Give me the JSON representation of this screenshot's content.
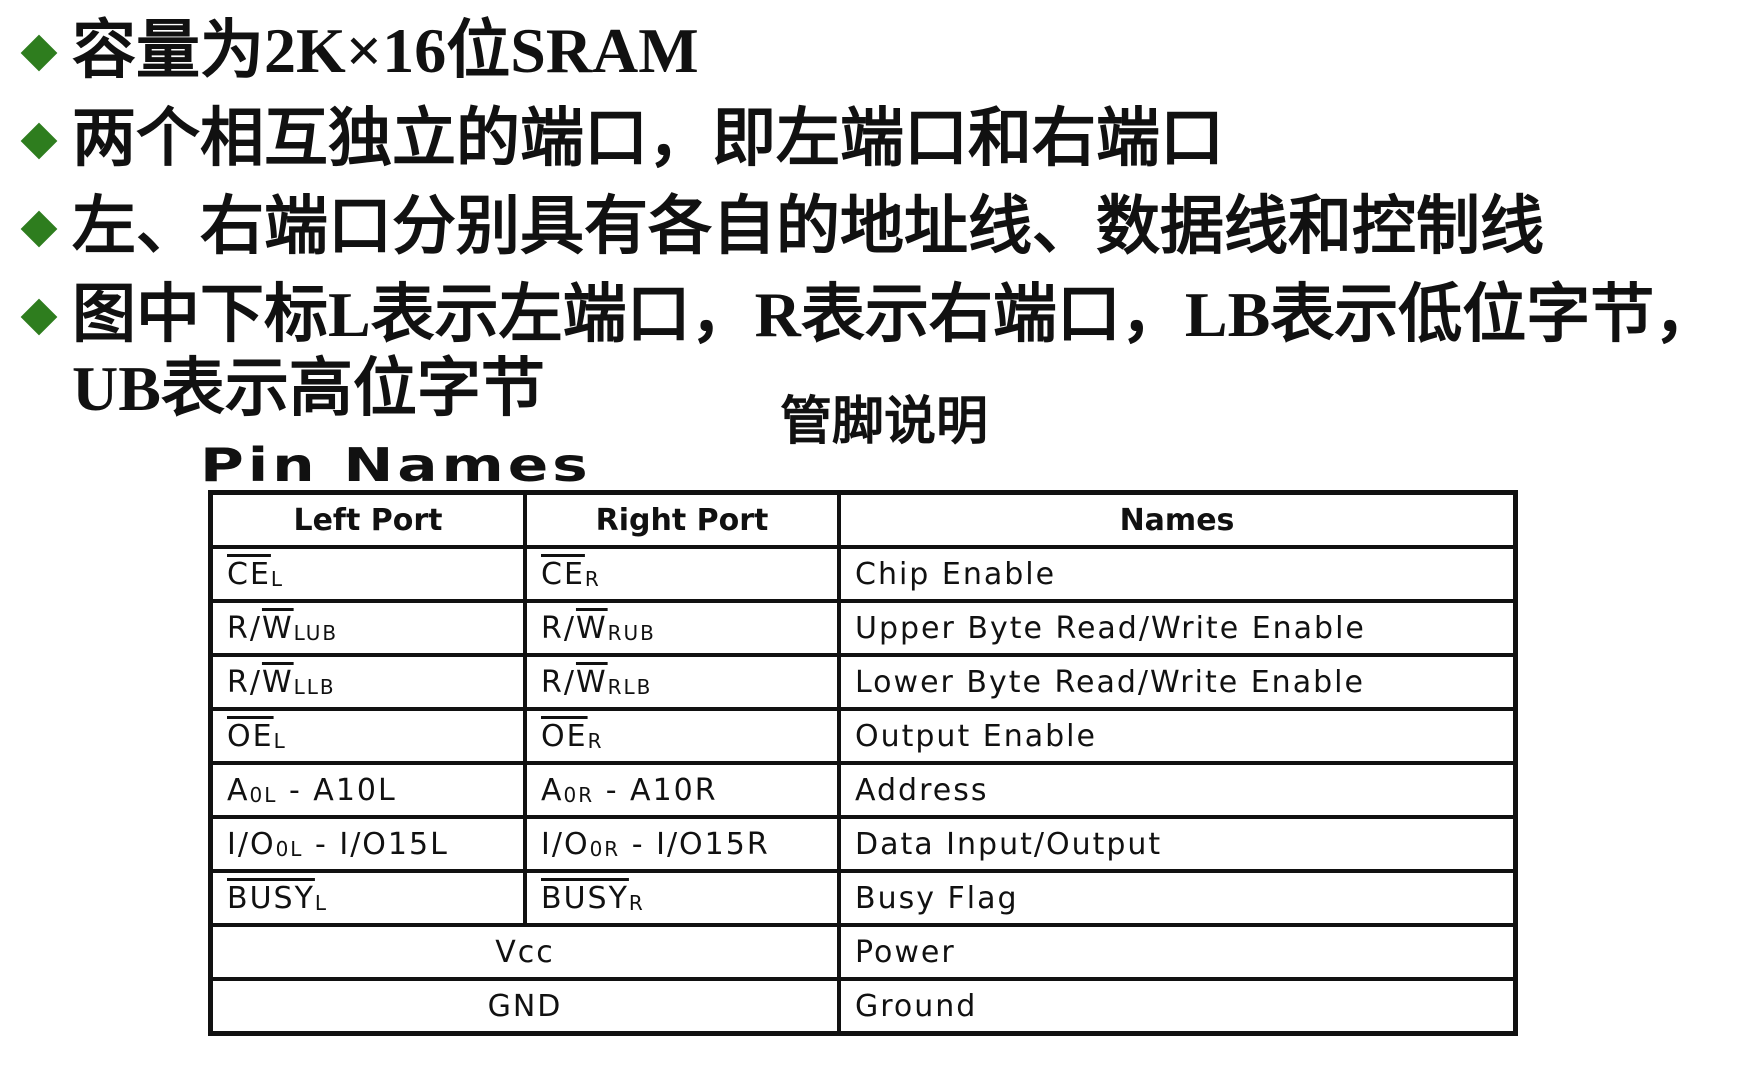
{
  "bullets": [
    "容量为2K×16位SRAM",
    "两个相互独立的端口，即左端口和右端口",
    "左、右端口分别具有各自的地址线、数据线和控制线",
    "图中下标L表示左端口，R表示右端口，LB表示低位字节，UB表示高位字节"
  ],
  "caption": "管脚说明",
  "pin_title": "Pin Names",
  "table": {
    "headers": [
      "Left Port",
      "Right Port",
      "Names"
    ],
    "rows": [
      {
        "left": {
          "over": "CE",
          "plain": "",
          "sub": "L",
          "tail": ""
        },
        "right": {
          "over": "CE",
          "plain": "",
          "sub": "R",
          "tail": ""
        },
        "name": "Chip Enable"
      },
      {
        "left": {
          "over": "W",
          "plain": "R/",
          "sub": "LUB",
          "tail": ""
        },
        "right": {
          "over": "W",
          "plain": "R/",
          "sub": "RUB",
          "tail": ""
        },
        "name": "Upper Byte Read/Write Enable"
      },
      {
        "left": {
          "over": "W",
          "plain": "R/",
          "sub": "LLB",
          "tail": ""
        },
        "right": {
          "over": "W",
          "plain": "R/",
          "sub": "RLB",
          "tail": ""
        },
        "name": "Lower Byte Read/Write Enable"
      },
      {
        "left": {
          "over": "OE",
          "plain": "",
          "sub": "L",
          "tail": ""
        },
        "right": {
          "over": "OE",
          "plain": "",
          "sub": "R",
          "tail": ""
        },
        "name": "Output Enable"
      },
      {
        "left": {
          "over": "",
          "plain": "A",
          "sub": "0L",
          "tail": " - A10L"
        },
        "right": {
          "over": "",
          "plain": "A",
          "sub": "0R",
          "tail": " - A10R"
        },
        "name": "Address"
      },
      {
        "left": {
          "over": "",
          "plain": "I/O",
          "sub": "0L",
          "tail": " - I/O15L"
        },
        "right": {
          "over": "",
          "plain": "I/O",
          "sub": "0R",
          "tail": " - I/O15R"
        },
        "name": "Data Input/Output"
      },
      {
        "left": {
          "over": "BUSY",
          "plain": "",
          "sub": "L",
          "tail": ""
        },
        "right": {
          "over": "BUSY",
          "plain": "",
          "sub": "R",
          "tail": ""
        },
        "name": "Busy Flag"
      }
    ],
    "merged_rows": [
      {
        "pin": "Vcc",
        "name": "Power"
      },
      {
        "pin": "GND",
        "name": "Ground"
      }
    ]
  },
  "colors": {
    "bullet": "#2e7d1e",
    "text": "#111111",
    "background": "#ffffff"
  }
}
